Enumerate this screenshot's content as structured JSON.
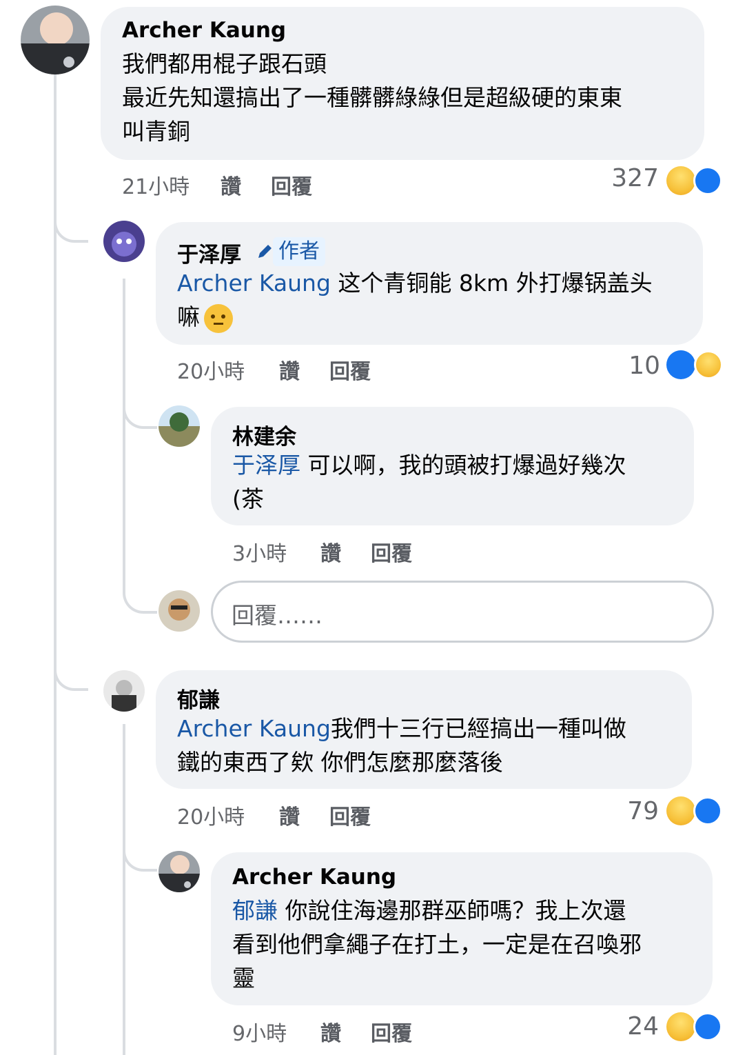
{
  "comments": [
    {
      "author": "Archer Kaung",
      "line1": "我們都用棍子跟石頭",
      "line2": "最近先知還搞出了一種髒髒綠綠但是超級硬的東東",
      "line3": "叫青銅",
      "time": "21小時",
      "like_label": "讚",
      "reply_label": "回覆",
      "reaction_count": "327"
    },
    {
      "author": "于泽厚",
      "badge": "作者",
      "mention": "Archer Kaung",
      "line1": " 这个青铜能 8km 外打爆锅盖头",
      "line2": "嘛",
      "time": "20小時",
      "like_label": "讚",
      "reply_label": "回覆",
      "reaction_count": "10"
    },
    {
      "author": "林建余",
      "mention": "于泽厚",
      "line1": " 可以啊，我的頭被打爆過好幾次",
      "line2": "(茶",
      "time": "3小時",
      "like_label": "讚",
      "reply_label": "回覆"
    },
    {
      "author": "郁謙",
      "mention": "Archer Kaung",
      "line1": "我們十三行已經搞出一種叫做",
      "line2": "鐵的東西了欸 你們怎麼那麼落後",
      "time": "20小時",
      "like_label": "讚",
      "reply_label": "回覆",
      "reaction_count": "79"
    },
    {
      "author": "Archer Kaung",
      "mention": "郁謙",
      "line1": " 你說住海邊那群巫師嗎？我上次還",
      "line2": "看到他們拿繩子在打土，一定是在召喚邪",
      "line3": "靈",
      "time": "9小時",
      "like_label": "讚",
      "reply_label": "回覆",
      "reaction_count": "24"
    }
  ],
  "reply_input": {
    "placeholder": "回覆……"
  },
  "colors": {
    "mention": "#1a58a6",
    "bubble": "#f0f2f5",
    "like": "#1877f2",
    "haha": "#f7c23b"
  }
}
